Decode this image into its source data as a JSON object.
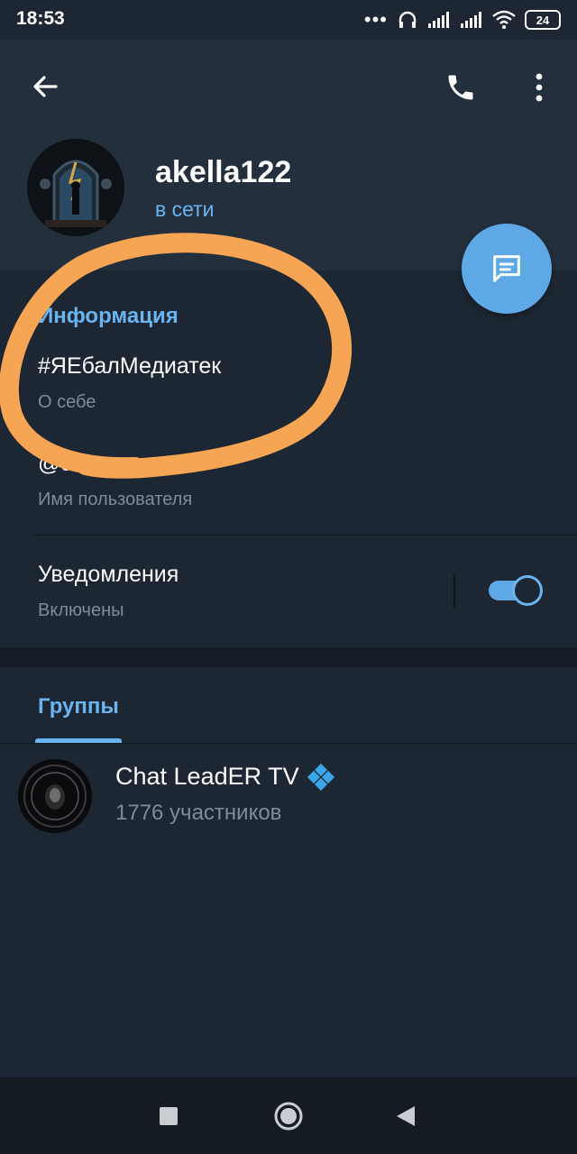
{
  "statusbar": {
    "time": "18:53",
    "dots": "•••",
    "battery": "24",
    "icons": [
      "headphones-icon",
      "signal-icon",
      "signal-icon",
      "wifi-icon",
      "battery-icon"
    ]
  },
  "header": {
    "back_icon": "arrow-left-icon",
    "call_icon": "phone-icon",
    "menu_icon": "more-vertical-icon",
    "username": "akella122",
    "status": "в сети"
  },
  "fab": {
    "icon": "message-icon"
  },
  "info": {
    "section_title": "Информация",
    "bio_value": "#ЯЕбалМедиатек",
    "bio_caption": "О себе",
    "username_value": "@ursna",
    "username_caption": "Имя пользователя"
  },
  "notifications": {
    "label": "Уведомления",
    "state": "Включены",
    "enabled": true
  },
  "tabs": {
    "active": "Группы"
  },
  "groups": [
    {
      "name": "Chat LeadER TV",
      "members": "1776 участников",
      "badge_icon": "diamond-icon"
    }
  ],
  "colors": {
    "background": "#1d2733",
    "header": "#242f3d",
    "accent": "#6ab4f0",
    "fab": "#5ea8e5",
    "annotation": "#f5a553"
  }
}
